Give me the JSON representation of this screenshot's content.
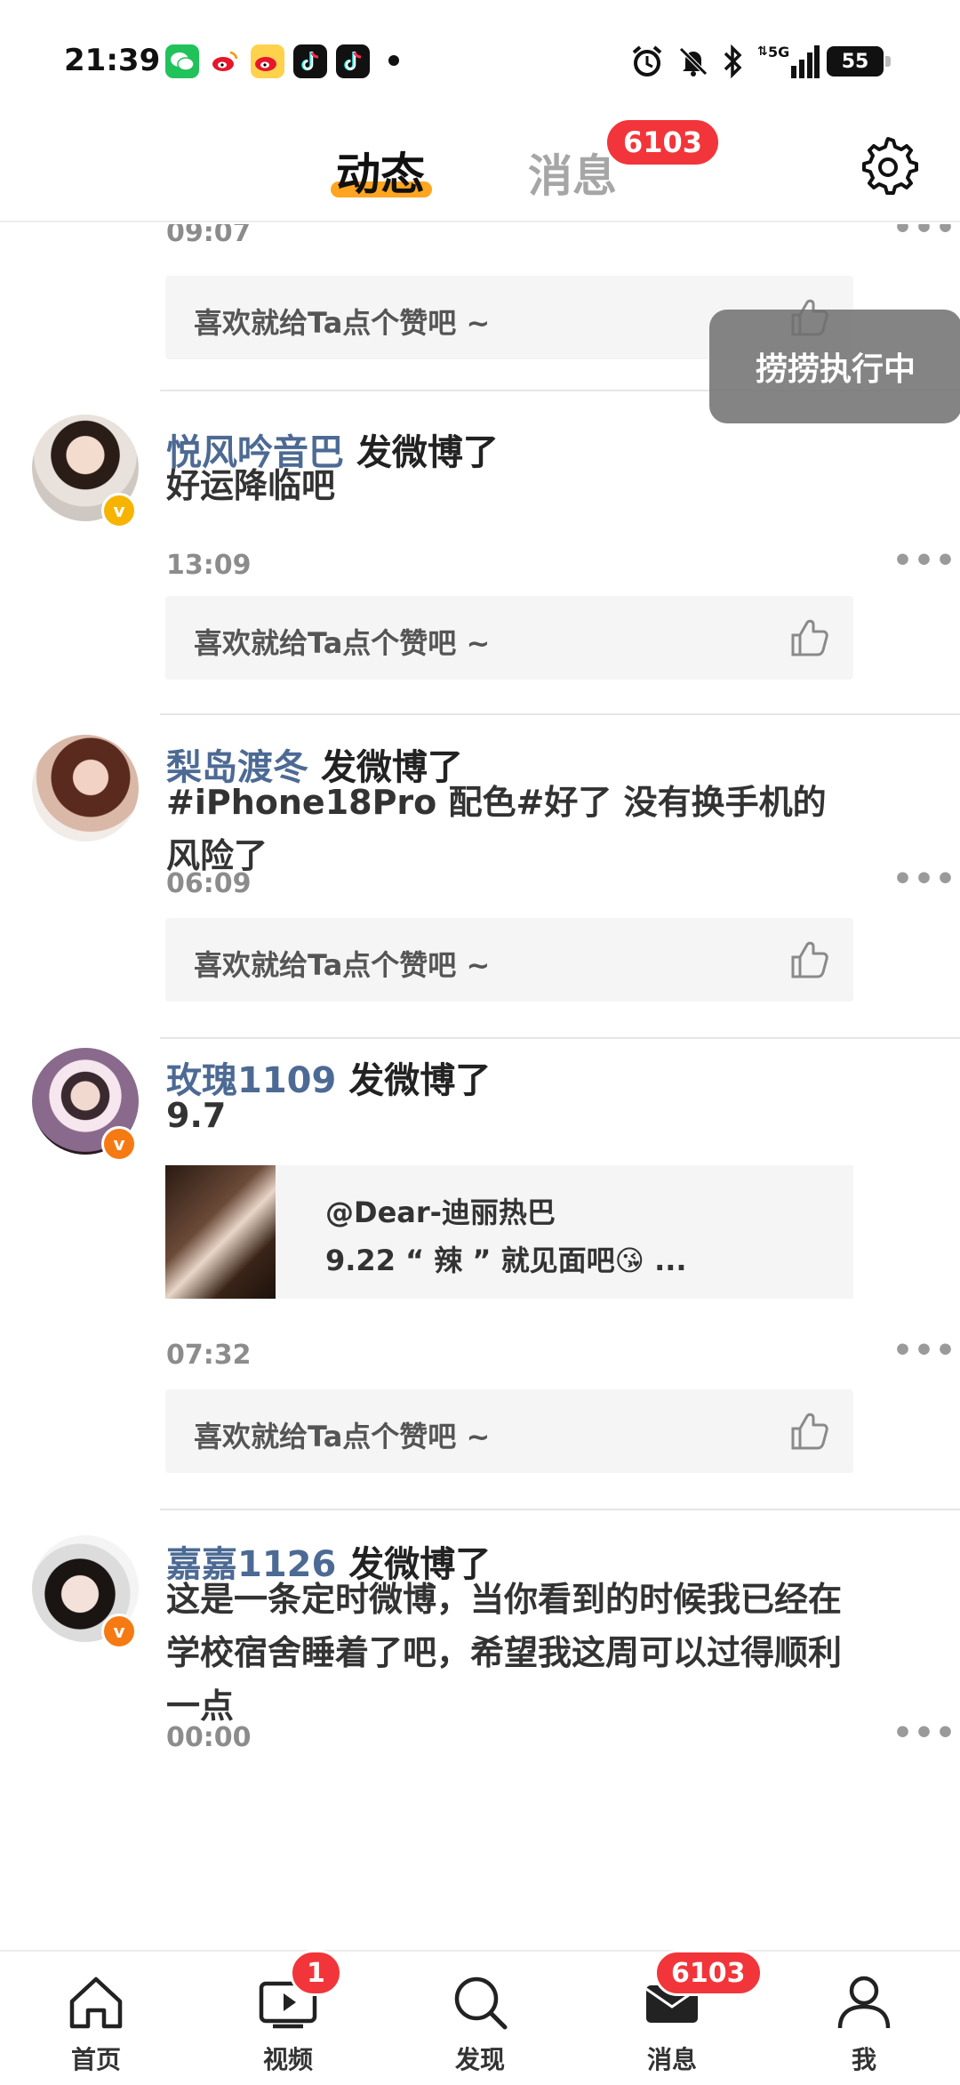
{
  "status_bar": {
    "time": "21:39",
    "app_icons": [
      "wechat-icon",
      "weibo-icon",
      "weibo-icon",
      "tiktok-icon",
      "tiktok-icon"
    ],
    "system_icons": [
      "alarm-icon",
      "mute-icon",
      "bluetooth-icon",
      "5g-signal-icon"
    ],
    "network": "5G",
    "battery": "55"
  },
  "header": {
    "tab_active": "动态",
    "tab_inactive": "消息",
    "message_badge": "6103",
    "accent_color": "#ffa51f"
  },
  "toast": "捞捞执行中",
  "like_prompt": "喜欢就给Ta点个赞吧 ~",
  "posts": [
    {
      "time": "09:07"
    },
    {
      "user": "悦风吟音巴",
      "action": "发微博了",
      "text": "好运降临吧",
      "time": "13:09",
      "verified_color": "#f6b400"
    },
    {
      "user": "梨岛渡冬",
      "action": "发微博了",
      "text": "#iPhone18Pro 配色#好了 没有换手机的风险了",
      "time": "06:09"
    },
    {
      "user": "玫瑰1109",
      "action": "发微博了",
      "text": "9.7",
      "repost_author": "@Dear-迪丽热巴",
      "repost_text": "9.22 “ 辣 ” 就见面吧😘 ...",
      "time": "07:32",
      "verified_color": "#f57a14"
    },
    {
      "user": "嘉嘉1126",
      "action": "发微博了",
      "text": "这是一条定时微博，当你看到的时候我已经在学校宿舍睡着了吧，希望我这周可以过得顺利一点",
      "time": "00:00",
      "verified_color": "#f57a14"
    }
  ],
  "bottom_nav": {
    "items": [
      {
        "label": "首页",
        "icon": "home-icon"
      },
      {
        "label": "视频",
        "icon": "video-icon",
        "badge": "1"
      },
      {
        "label": "发现",
        "icon": "search-icon"
      },
      {
        "label": "消息",
        "icon": "message-icon",
        "badge": "6103"
      },
      {
        "label": "我",
        "icon": "profile-icon"
      }
    ]
  },
  "colors": {
    "badge": "#f2353a",
    "username": "#4c6a94"
  }
}
